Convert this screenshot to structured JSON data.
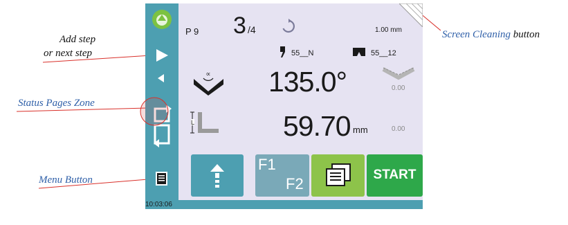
{
  "annotations": {
    "add_step_line1": "Add step",
    "add_step_line2": "or next step",
    "screen_cleaning_blue": "Screen Cleaning",
    "screen_cleaning_rest": " button",
    "status_pages_zone": "Status Pages Zone",
    "menu_button": "Menu Button"
  },
  "header": {
    "program": "P 9",
    "step_current": "3",
    "step_total": "/4",
    "thickness": "1.00 mm"
  },
  "tooling": {
    "punch": "55__N",
    "die": "55__12"
  },
  "angle": {
    "value": "135.0°",
    "correction": "0.00"
  },
  "length": {
    "value": "59.70",
    "unit": "mm",
    "correction": "0.00"
  },
  "bottom_buttons": {
    "f1": "F1",
    "f2": "F2",
    "start": "START"
  },
  "status_bar": {
    "time": "10:03:06"
  },
  "colors": {
    "sidebar": "#4d9fb1",
    "screen_bg": "#e6e3f2",
    "button_blue": "#4d9fb1",
    "button_green": "#8dc34a",
    "start_green": "#2ea84a",
    "annotation_line": "#d9302a"
  },
  "icons": {
    "status_led": "green-circle-icon",
    "next_step": "play-arrow-icon",
    "prev_step": "left-arrow-icon",
    "status_pages": "page-switch-icon",
    "menu": "document-menu-icon",
    "repeat": "cycle-icon",
    "clean": "screen-cleaning-icon",
    "punch": "punch-icon",
    "die": "die-icon",
    "angle": "bend-angle-icon",
    "length": "flange-length-icon",
    "step_up": "up-arrow-icon",
    "pages": "pages-icon"
  }
}
